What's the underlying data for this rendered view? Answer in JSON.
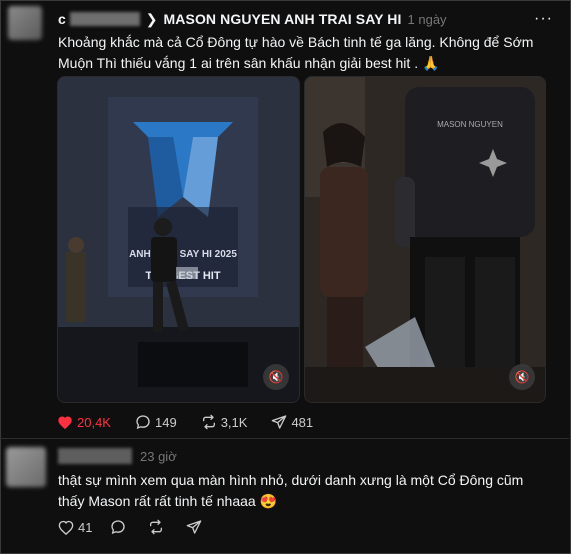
{
  "post": {
    "author": "MASON NGUYEN ANH TRAI SAY HI",
    "handle_prefix": "c",
    "time": "1 ngày",
    "more": "···",
    "caption": "Khoảng khắc mà cả Cổ Đông tự hào về Bách tinh tế ga lăng. Không để Sớm Muộn Thì thiếu vắng 1 ai trên sân khấu nhận giải best hit . 🙏",
    "media": [
      {
        "description_label": "ANH TRAI SAY HI 2025",
        "overlay_title": "THE BEST HIT"
      },
      {
        "shirt_text": "MASON NGUYEN"
      }
    ],
    "mute_icon": "🔇",
    "stats": {
      "likes": "20,4K",
      "comments": "149",
      "reposts": "3,1K",
      "shares": "481"
    }
  },
  "reply": {
    "time": "23 giờ",
    "text": "thật sự mình xem qua màn hình nhỏ, dưới danh xưng là một Cổ Đông cũm thấy Mason rất rất tinh tế nhaaa 😍",
    "likes": "41"
  },
  "colors": {
    "background": "#0f0f0f",
    "like": "#ff3040",
    "muted_text": "#777777"
  }
}
